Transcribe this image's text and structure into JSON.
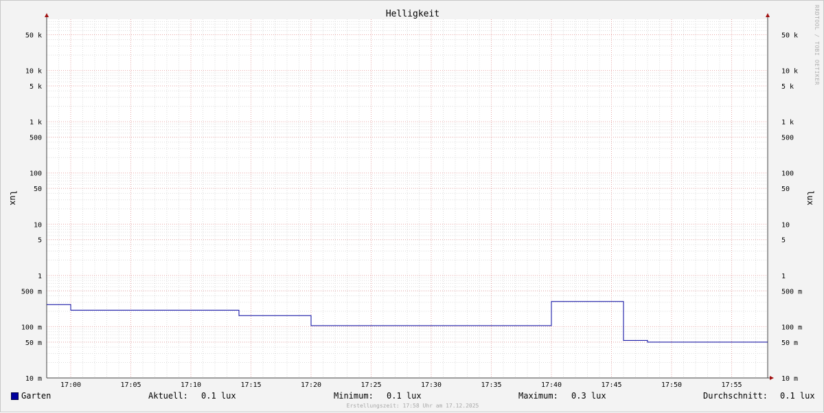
{
  "watermark": "RRDTOOL / TOBI OETIKER",
  "footer": "Erstellungszeit: 17:58 Uhr am 17.12.2025",
  "legend": {
    "series_name": "Garten",
    "series_color": "#00009e",
    "current_label": "Aktuell:",
    "current_value": "0.1 lux",
    "min_label": "Minimum:",
    "min_value": "0.1 lux",
    "max_label": "Maximum:",
    "max_value": "0.3 lux",
    "avg_label": "Durchschnitt:",
    "avg_value": "0.1 lux"
  },
  "chart_data": {
    "type": "line",
    "title": "Helligkeit",
    "ylabel": "lux",
    "ylabel_right": "lux",
    "yscale": "log",
    "ylim": [
      0.01,
      100000
    ],
    "xlim": [
      "16:58",
      "17:58"
    ],
    "x_ticks": [
      "17:00",
      "17:05",
      "17:10",
      "17:15",
      "17:20",
      "17:25",
      "17:30",
      "17:35",
      "17:40",
      "17:45",
      "17:50",
      "17:55"
    ],
    "y_ticks": [
      {
        "value": 50000,
        "label": "50 k"
      },
      {
        "value": 10000,
        "label": "10 k"
      },
      {
        "value": 5000,
        "label": "5 k"
      },
      {
        "value": 1000,
        "label": "1 k"
      },
      {
        "value": 500,
        "label": "500"
      },
      {
        "value": 100,
        "label": "100"
      },
      {
        "value": 50,
        "label": "50"
      },
      {
        "value": 10,
        "label": "10"
      },
      {
        "value": 5,
        "label": "5"
      },
      {
        "value": 1,
        "label": "1"
      },
      {
        "value": 0.5,
        "label": "500 m"
      },
      {
        "value": 0.1,
        "label": "100 m"
      },
      {
        "value": 0.05,
        "label": "50 m"
      },
      {
        "value": 0.01,
        "label": "10 m"
      }
    ],
    "grid": true,
    "series": [
      {
        "name": "Garten",
        "color": "#00009e",
        "step": true,
        "points": [
          {
            "x": "16:58",
            "y": 0.27
          },
          {
            "x": "17:00",
            "y": 0.21
          },
          {
            "x": "17:14",
            "y": 0.165
          },
          {
            "x": "17:20",
            "y": 0.105
          },
          {
            "x": "17:40",
            "y": 0.31
          },
          {
            "x": "17:46",
            "y": 0.054
          },
          {
            "x": "17:48",
            "y": 0.05
          },
          {
            "x": "17:58",
            "y": 0.05
          }
        ]
      }
    ]
  }
}
